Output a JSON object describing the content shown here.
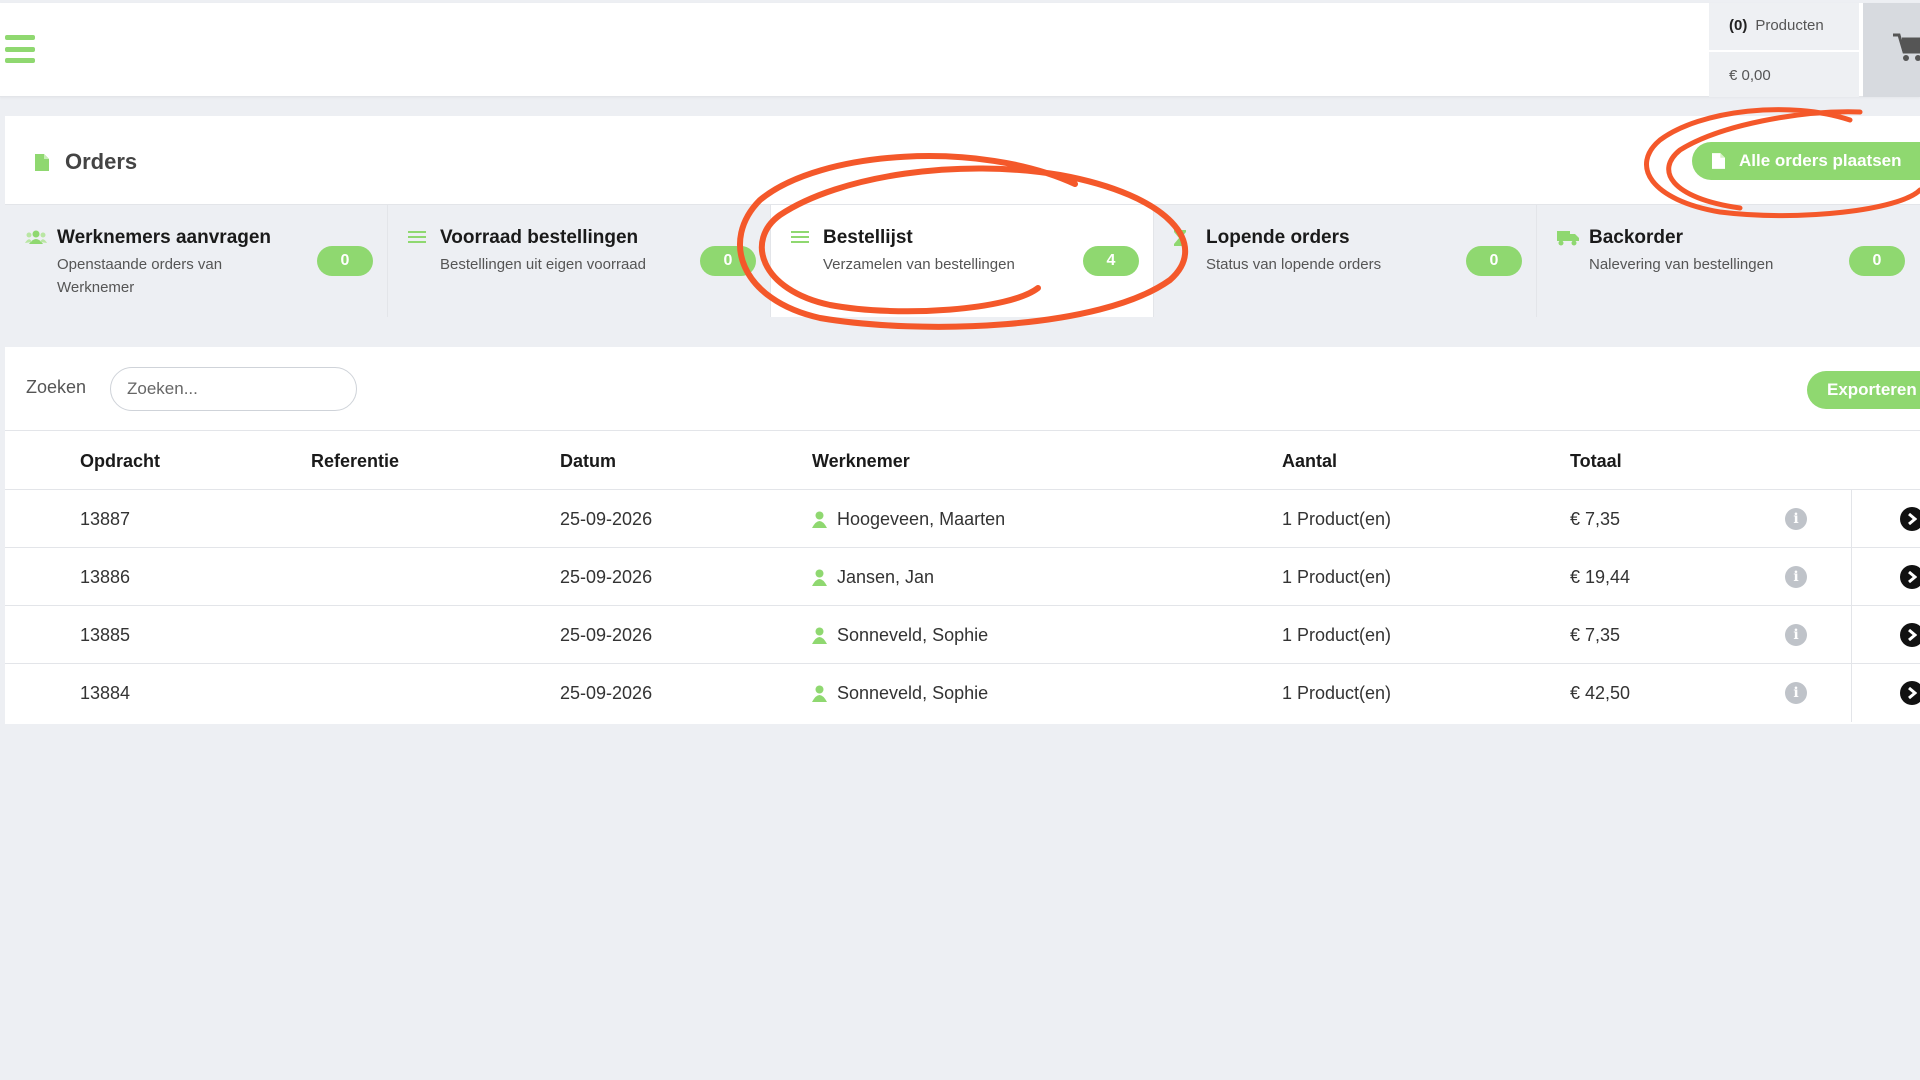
{
  "header": {
    "menu_icon": "hamburger-menu-icon",
    "cart_count": "(0)",
    "cart_products_label": "Producten",
    "cart_total": "€ 0,00",
    "cart_icon": "shopping-cart-icon"
  },
  "orders": {
    "title": "Orders",
    "title_icon": "document-icon",
    "place_all_label": "Alle orders plaatsen",
    "tabs": [
      {
        "title": "Werknemers aanvragen",
        "subtitle": "Openstaande orders van Werknemer",
        "badge": "0",
        "icon": "users-icon"
      },
      {
        "title": "Voorraad bestellingen",
        "subtitle": "Bestellingen uit eigen voorraad",
        "badge": "0",
        "icon": "list-icon"
      },
      {
        "title": "Bestellijst",
        "subtitle": "Verzamelen van bestellingen",
        "badge": "4",
        "icon": "list-icon"
      },
      {
        "title": "Lopende orders",
        "subtitle": "Status van lopende orders",
        "badge": "0",
        "icon": "hourglass-icon"
      },
      {
        "title": "Backorder",
        "subtitle": "Nalevering van bestellingen",
        "badge": "0",
        "icon": "truck-icon"
      }
    ],
    "active_tab": 2
  },
  "table": {
    "search_label": "Zoeken",
    "search_placeholder": "Zoeken...",
    "search_value": "",
    "export_label": "Exporteren",
    "columns": [
      "Opdracht",
      "Referentie",
      "Datum",
      "Werknemer",
      "Aantal",
      "Totaal"
    ],
    "rows": [
      {
        "opdracht": "13887",
        "referentie": "",
        "datum": "25-09-2026",
        "werknemer": "Hoogeveen, Maarten",
        "aantal": "1 Product(en)",
        "totaal": "€ 7,35"
      },
      {
        "opdracht": "13886",
        "referentie": "",
        "datum": "25-09-2026",
        "werknemer": "Jansen, Jan",
        "aantal": "1 Product(en)",
        "totaal": "€ 19,44"
      },
      {
        "opdracht": "13885",
        "referentie": "",
        "datum": "25-09-2026",
        "werknemer": "Sonneveld, Sophie",
        "aantal": "1 Product(en)",
        "totaal": "€ 7,35"
      },
      {
        "opdracht": "13884",
        "referentie": "",
        "datum": "25-09-2026",
        "werknemer": "Sonneveld, Sophie",
        "aantal": "1 Product(en)",
        "totaal": "€ 42,50"
      }
    ],
    "info_icon": "info-icon",
    "row_action_icon": "chevron-right-circle-icon"
  },
  "colors": {
    "accent_green": "#8fd870",
    "annotation_orange": "#f4582a",
    "background": "#edeff3"
  }
}
